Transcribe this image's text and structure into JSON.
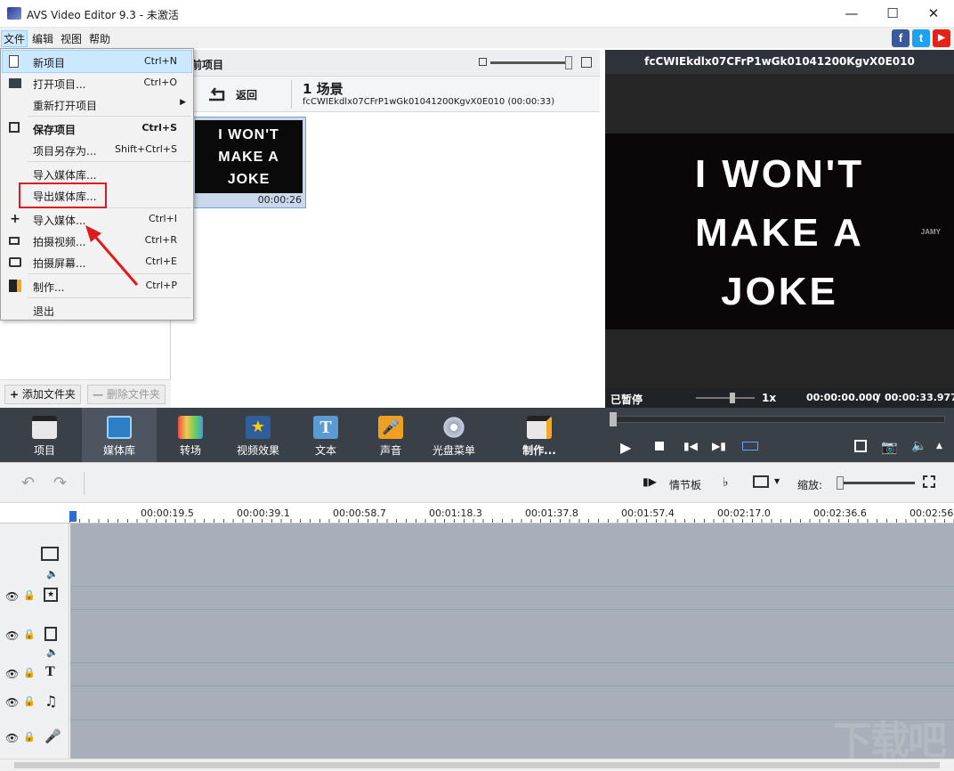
{
  "window": {
    "title": "AVS Video Editor 9.3 - 未激活"
  },
  "menubar": {
    "file": "文件",
    "edit": "编辑",
    "view": "视图",
    "help": "帮助"
  },
  "social": {
    "facebook": "f",
    "twitter": "t",
    "youtube": "▶"
  },
  "file_menu": {
    "new_project": {
      "label": "新项目",
      "shortcut": "Ctrl+N"
    },
    "open_project": {
      "label": "打开项目...",
      "shortcut": "Ctrl+O"
    },
    "reopen_project": {
      "label": "重新打开项目"
    },
    "save_project": {
      "label": "保存项目",
      "shortcut": "Ctrl+S"
    },
    "save_as": {
      "label": "项目另存为...",
      "shortcut": "Shift+Ctrl+S"
    },
    "import_library": {
      "label": "导入媒体库..."
    },
    "export_library": {
      "label": "导出媒体库..."
    },
    "import_media": {
      "label": "导入媒体...",
      "shortcut": "Ctrl+I"
    },
    "capture_video": {
      "label": "拍摄视频...",
      "shortcut": "Ctrl+R"
    },
    "capture_screen": {
      "label": "拍摄屏幕...",
      "shortcut": "Ctrl+E"
    },
    "produce": {
      "label": "制作...",
      "shortcut": "Ctrl+P"
    },
    "exit": {
      "label": "退出"
    }
  },
  "left_panel": {
    "add_folder": "添加文件夹",
    "remove_folder": "删除文件夹"
  },
  "media": {
    "header": "前项目",
    "back": "返回",
    "scene_title": "1 场景",
    "scene_file": "fcCWIEkdlx07CFrP1wGk01041200KgvX0E010 (00:00:33)",
    "thumb_text": [
      "I WON'T",
      "MAKE A",
      "JOKE"
    ],
    "thumb_duration": "00:00:26"
  },
  "preview": {
    "title": "fcCWIEkdlx07CFrP1wGk01041200KgvX0E010",
    "frame_text": [
      "I WON'T",
      "MAKE A",
      "JOKE"
    ],
    "watermark_small": "JAMY",
    "status": "已暂停",
    "speed": "1x",
    "time_current": "00:00:00.000",
    "time_sep": "/",
    "time_total": "00:00:33.977"
  },
  "toolbar": {
    "project": "项目",
    "library": "媒体库",
    "transitions": "转场",
    "effects": "视频效果",
    "text": "文本",
    "audio": "声音",
    "disc_menu": "光盘菜单",
    "produce": "制作..."
  },
  "timeline": {
    "storyboard": "情节板",
    "zoom": "缩放:",
    "ticks": [
      "00:00:19.5",
      "00:00:39.1",
      "00:00:58.7",
      "00:01:18.3",
      "00:01:37.8",
      "00:01:57.4",
      "00:02:17.0",
      "00:02:36.6",
      "00:02:56."
    ]
  },
  "watermark": "下载吧",
  "colors": {
    "highlight": "#cce8ff",
    "red_box": "#e0191e",
    "toolbar": "#3a4048",
    "timeline_track": "#a7b0ba"
  }
}
